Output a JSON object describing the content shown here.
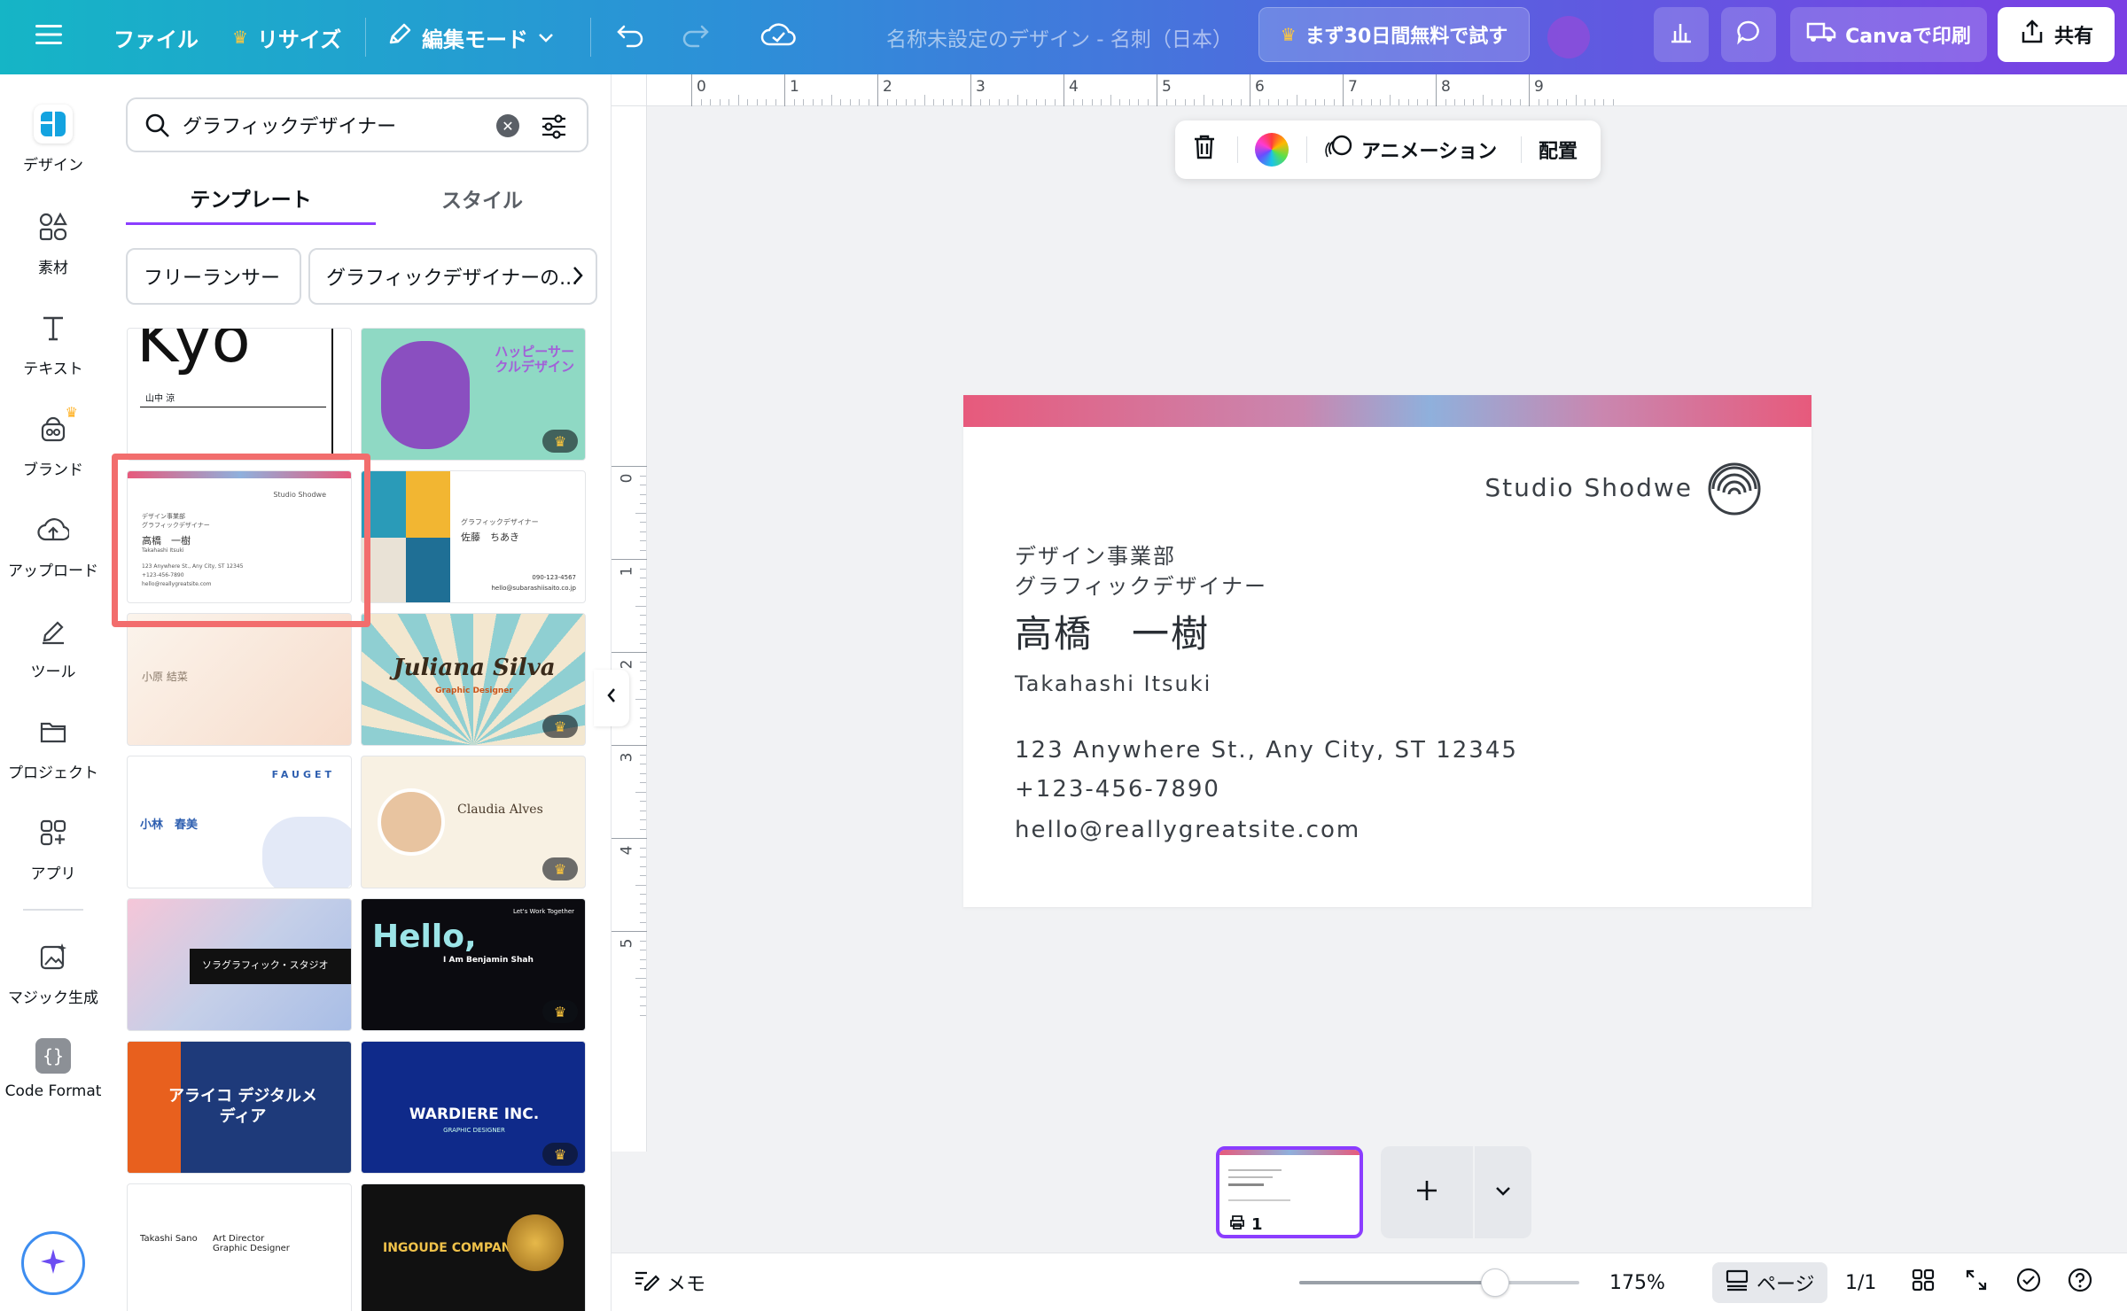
{
  "topbar": {
    "menu_icon": "hamburger-icon",
    "file_label": "ファイル",
    "resize_label": "リサイズ",
    "edit_mode_label": "編集モード",
    "doc_title": "名称未設定のデザイン - 名刺（日本）",
    "trial_label": "まず30日間無料で試す",
    "print_label": "Canvaで印刷",
    "share_label": "共有"
  },
  "rail": {
    "items": [
      {
        "label": "デザイン",
        "icon": "design-icon"
      },
      {
        "label": "素材",
        "icon": "elements-icon"
      },
      {
        "label": "テキスト",
        "icon": "text-icon"
      },
      {
        "label": "ブランド",
        "icon": "brand-icon"
      },
      {
        "label": "アップロード",
        "icon": "upload-icon"
      },
      {
        "label": "ツール",
        "icon": "draw-icon"
      },
      {
        "label": "プロジェクト",
        "icon": "folder-icon"
      },
      {
        "label": "アプリ",
        "icon": "apps-icon"
      },
      {
        "label": "マジック生成",
        "icon": "magic-media-icon"
      },
      {
        "label": "Code Format",
        "icon": "code-format-icon"
      }
    ]
  },
  "panel": {
    "search_value": "グラフィックデザイナー",
    "tabs": [
      "テンプレート",
      "スタイル"
    ],
    "chips": [
      "フリーランサー",
      "グラフィックデザイナーの..."
    ],
    "templates": {
      "t1_name": "山中 涼",
      "t1_big": "Kyo",
      "t2_text": "ハッピーサークルデザイン",
      "t3_company": "Studio Shodwe",
      "t3_dept": "デザイン事業部",
      "t3_role": "グラフィックデザイナー",
      "t3_name": "高橋　一樹",
      "t3_roman": "Takahashi Itsuki",
      "t3_addr": "123 Anywhere St., Any City, ST 12345",
      "t3_phone": "+123-456-7890",
      "t3_email": "hello@reallygreatsite.com",
      "t4_role": "グラフィックデザイナー",
      "t4_name": "佐藤　ちあき",
      "t4_phone": "090-123-4567",
      "t4_email": "hello@subarashiisaito.co.jp",
      "t5_name": "小原 結菜",
      "t6_name": "Juliana Silva",
      "t6_role": "Graphic Designer",
      "t7_brand": "FAUGET",
      "t7_name": "小林　春美",
      "t8_name": "Claudia Alves",
      "t9_text": "ソラグラフィック・スタジオ",
      "t10_hello": "Hello,",
      "t10_name": "I Am Benjamin Shah",
      "t10_top": "Let's Work Together",
      "t11_text": "アライコ デジタルメディア",
      "t12_text": "WARDIERE INC.",
      "t12_sub": "GRAPHIC DESIGNER",
      "t13_name": "Takashi Sano",
      "t13_role": "Art Director Graphic Designer",
      "t14_text": "INGOUDE COMPANY"
    }
  },
  "canvas": {
    "ruler_h": [
      "0",
      "1",
      "2",
      "3",
      "4",
      "5",
      "6",
      "7",
      "8",
      "9"
    ],
    "ruler_v": [
      "0",
      "1",
      "2",
      "3",
      "4",
      "5"
    ],
    "toolbar": {
      "animation_label": "アニメーション",
      "position_label": "配置"
    },
    "card": {
      "company": "Studio Shodwe",
      "dept": "デザイン事業部",
      "role": "グラフィックデザイナー",
      "name": "高橋　一樹",
      "roman": "Takahashi  Itsuki",
      "address": "123 Anywhere St., Any City, ST 12345",
      "phone": "+123-456-7890",
      "email": "hello@reallygreatsite.com"
    },
    "page_number": "1"
  },
  "footer": {
    "notes_label": "メモ",
    "zoom": "175%",
    "zoom_level": 0.7,
    "pages_label": "ページ",
    "page_count": "1/1"
  },
  "colors": {
    "accent": "#8b3dff",
    "highlight": "#f26d6d"
  }
}
